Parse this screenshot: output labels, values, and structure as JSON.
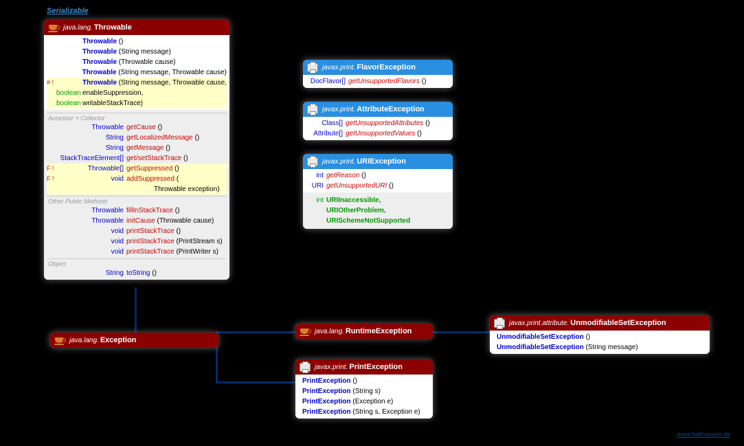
{
  "serializable": "Serializable",
  "footer": "www.falkhausen.de",
  "throwable": {
    "pkg": "java.lang.",
    "name": "Throwable",
    "ctors": [
      {
        "mod": "",
        "t": "",
        "n": "Throwable",
        "p": "()"
      },
      {
        "mod": "",
        "t": "",
        "n": "Throwable",
        "p": "(String message)"
      },
      {
        "mod": "",
        "t": "",
        "n": "Throwable",
        "p": "(Throwable cause)"
      },
      {
        "mod": "",
        "t": "",
        "n": "Throwable",
        "p": "(String message, Throwable cause)"
      },
      {
        "mod": "# !",
        "t": "",
        "n": "Throwable",
        "p": "(String message, Throwable cause,",
        "hl": true
      },
      {
        "mod": "",
        "t": "boolean",
        "n": "",
        "p": "enableSuppression,",
        "green": true,
        "hl": true
      },
      {
        "mod": "",
        "t": "boolean",
        "n": "",
        "p": "writableStackTrace)",
        "green": true,
        "hl": true
      }
    ],
    "sect1": "Accessor + Collector",
    "acc": [
      {
        "mod": "",
        "t": "Throwable",
        "n": "getCause",
        "p": "()"
      },
      {
        "mod": "",
        "t": "String",
        "n": "getLocalizedMessage",
        "p": "()"
      },
      {
        "mod": "",
        "t": "String",
        "n": "getMessage",
        "p": "()"
      },
      {
        "mod": "",
        "t": "StackTraceElement[]",
        "n": "get/setStackTrace",
        "p": "()"
      },
      {
        "mod": "F !",
        "t": "Throwable[]",
        "n": "getSuppressed",
        "p": "()",
        "hl": true
      },
      {
        "mod": "F !",
        "t": "void",
        "n": "addSuppressed",
        "p": "(",
        "hl": true
      },
      {
        "mod": "",
        "t": "",
        "n": "",
        "p": "Throwable exception)",
        "indent": true,
        "hl": true
      }
    ],
    "sect2": "Other Public Methods",
    "oth": [
      {
        "t": "Throwable",
        "n": "fillInStackTrace",
        "p": "()"
      },
      {
        "t": "Throwable",
        "n": "initCause",
        "p": "(Throwable cause)"
      },
      {
        "t": "void",
        "n": "printStackTrace",
        "p": "()"
      },
      {
        "t": "void",
        "n": "printStackTrace",
        "p": "(PrintStream s)"
      },
      {
        "t": "void",
        "n": "printStackTrace",
        "p": "(PrintWriter s)"
      }
    ],
    "sect3": "Object",
    "obj": [
      {
        "t": "String",
        "n": "toString",
        "p": "()"
      }
    ]
  },
  "exception": {
    "pkg": "java.lang.",
    "name": "Exception"
  },
  "runtime": {
    "pkg": "java.lang.",
    "name": "RuntimeException"
  },
  "printex": {
    "pkg": "javax.print.",
    "name": "PrintException",
    "rows": [
      {
        "n": "PrintException",
        "p": "()"
      },
      {
        "n": "PrintException",
        "p": "(String s)"
      },
      {
        "n": "PrintException",
        "p": "(Exception e)"
      },
      {
        "n": "PrintException",
        "p": "(String s, Exception e)"
      }
    ]
  },
  "unmod": {
    "pkg": "javax.print.attribute.",
    "name": "UnmodifiableSetException",
    "rows": [
      {
        "n": "UnmodifiableSetException",
        "p": "()"
      },
      {
        "n": "UnmodifiableSetException",
        "p": "(String message)"
      }
    ]
  },
  "flavor": {
    "pkg": "javax.print.",
    "name": "FlavorException",
    "rows": [
      {
        "t": "DocFlavor[]",
        "n": "getUnsupportedFlavors",
        "p": "()"
      }
    ]
  },
  "attr": {
    "pkg": "javax.print.",
    "name": "AttributeException",
    "rows": [
      {
        "t": "Class[]",
        "n": "getUnsupportedAttributes",
        "p": "()"
      },
      {
        "t": "Attribute[]",
        "n": "getUnsupportedValues",
        "p": "()"
      }
    ]
  },
  "uri": {
    "pkg": "javax.print.",
    "name": "URIException",
    "rows": [
      {
        "t": "int",
        "n": "getReason",
        "p": "()"
      },
      {
        "t": "URI",
        "n": "getUnsupportedURI",
        "p": "()"
      }
    ],
    "consts": [
      "URIInaccessible,",
      "URIOtherProblem,",
      "URISchemeNotSupported"
    ],
    "constT": "int"
  }
}
